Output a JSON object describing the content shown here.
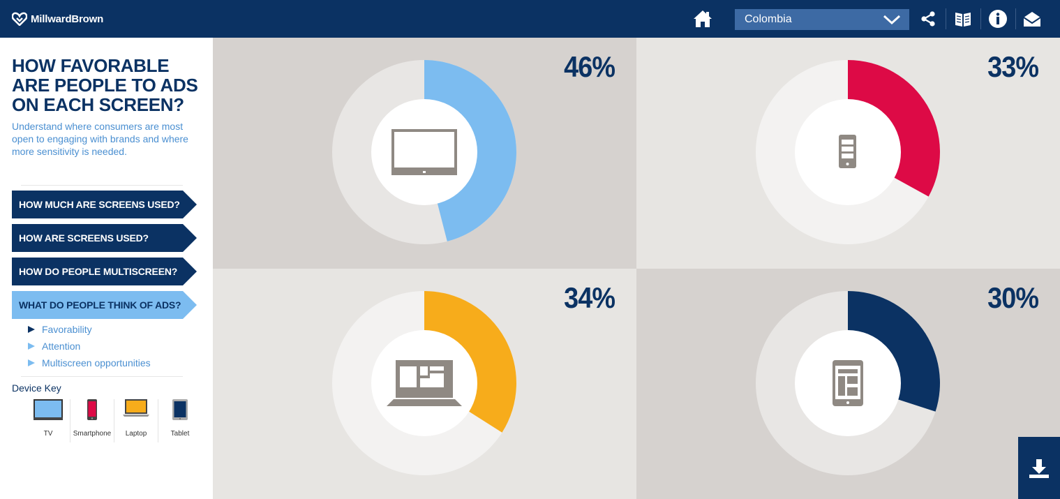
{
  "header": {
    "brand": "MillwardBrown",
    "country_selected": "Colombia",
    "icons": [
      "home-icon",
      "share-icon",
      "book-icon",
      "info-icon",
      "mail-icon"
    ]
  },
  "sidebar": {
    "title": "HOW FAVORABLE ARE PEOPLE TO ADS ON EACH SCREEN?",
    "subtitle": "Understand where consumers are most open to engaging with brands and where more sensitivity is needed.",
    "nav": [
      {
        "label": "HOW MUCH ARE SCREENS USED?"
      },
      {
        "label": "HOW ARE SCREENS USED?"
      },
      {
        "label": "HOW DO PEOPLE MULTISCREEN?"
      },
      {
        "label": "WHAT DO PEOPLE THINK OF ADS?"
      }
    ],
    "sub_items": [
      {
        "label": "Favorability"
      },
      {
        "label": "Attention"
      },
      {
        "label": "Multiscreen opportunities"
      }
    ],
    "device_key_title": "Device Key",
    "device_key": [
      {
        "label": "TV",
        "color": "#7cbcf0"
      },
      {
        "label": "Smartphone",
        "color": "#dd0a46"
      },
      {
        "label": "Laptop",
        "color": "#f7ac1b"
      },
      {
        "label": "Tablet",
        "color": "#0b3263"
      }
    ]
  },
  "chart_data": {
    "type": "pie",
    "charts": [
      {
        "device": "TV",
        "value": 46,
        "label": "46%",
        "color": "#7cbcf0"
      },
      {
        "device": "Smartphone",
        "value": 33,
        "label": "33%",
        "color": "#dd0a46"
      },
      {
        "device": "Laptop",
        "value": 34,
        "label": "34%",
        "color": "#f7ac1b"
      },
      {
        "device": "Tablet",
        "value": 30,
        "label": "30%",
        "color": "#0b3263"
      }
    ]
  }
}
